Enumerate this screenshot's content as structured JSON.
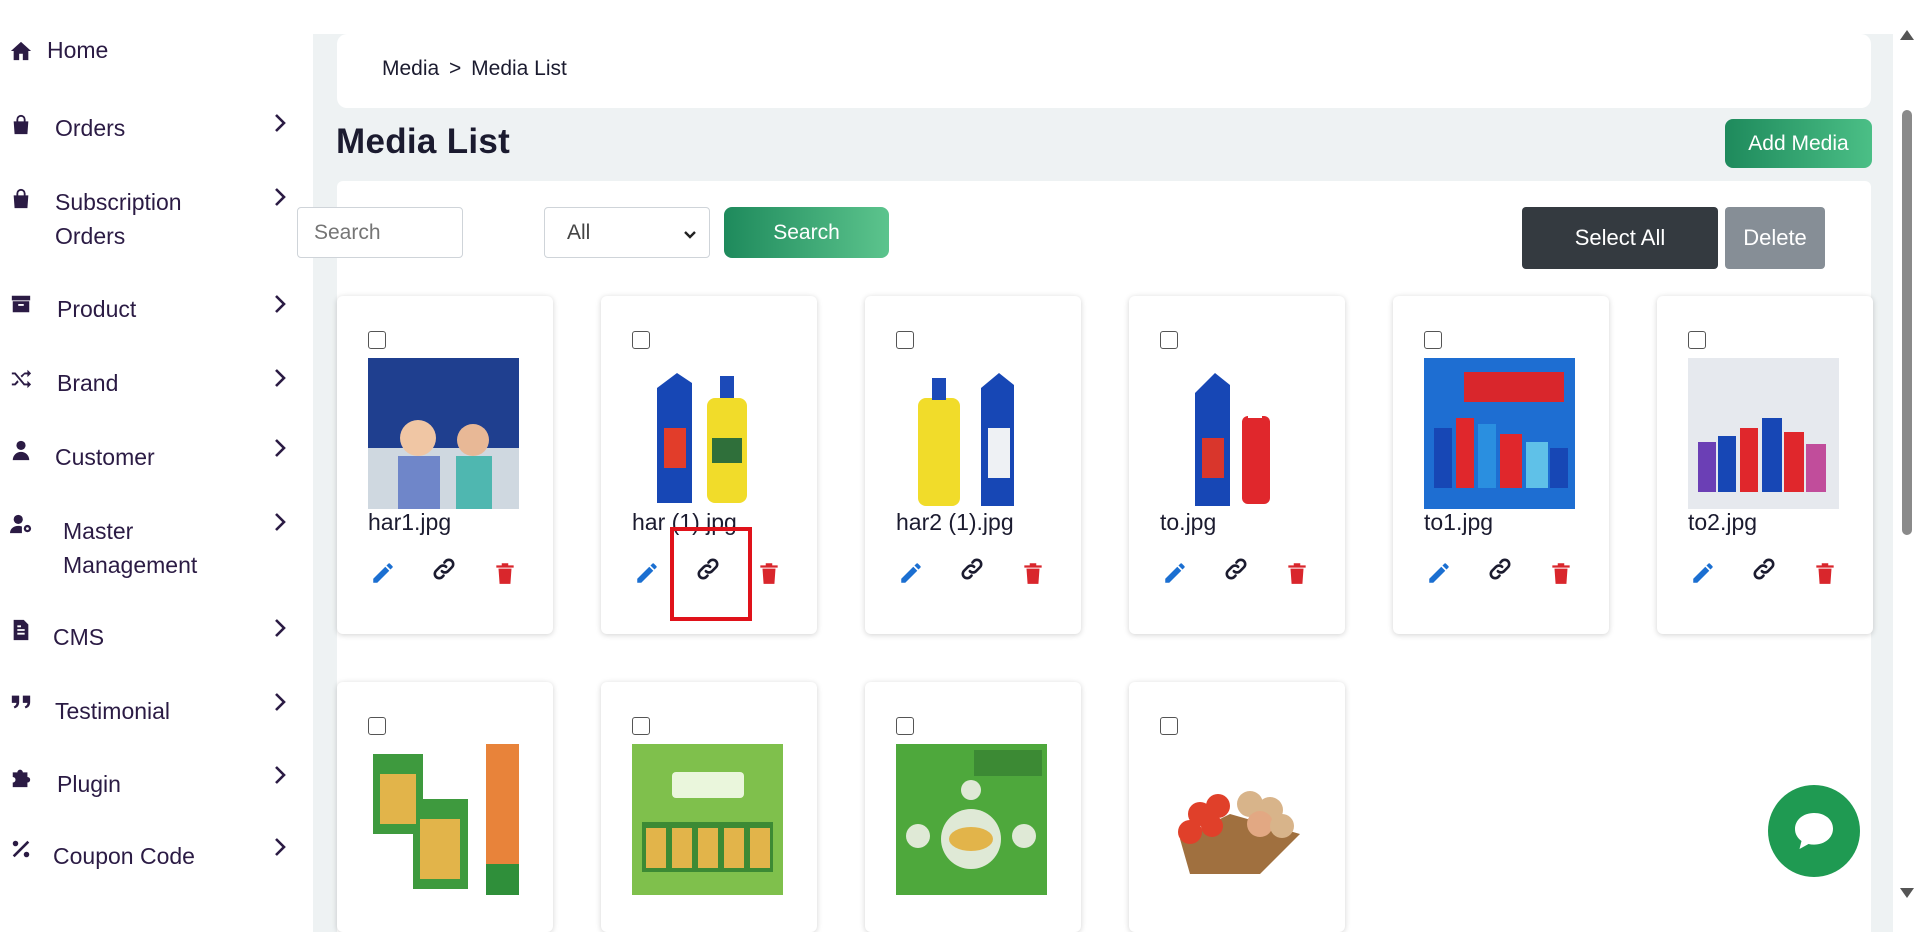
{
  "sidebar": {
    "items": [
      {
        "label": "Home",
        "icon": "home-icon",
        "has_chevron": false
      },
      {
        "label": "Orders",
        "icon": "shopping-bag-icon",
        "has_chevron": true
      },
      {
        "label": "Subscription Orders",
        "line1": "Subscription",
        "line2": "Orders",
        "icon": "shopping-bag-icon",
        "has_chevron": true
      },
      {
        "label": "Product",
        "icon": "archive-box-icon",
        "has_chevron": true
      },
      {
        "label": "Brand",
        "icon": "shuffle-icon",
        "has_chevron": true
      },
      {
        "label": "Customer",
        "icon": "user-icon",
        "has_chevron": true
      },
      {
        "label": "Master Management",
        "line1": "Master",
        "line2": "Management",
        "icon": "user-gear-icon",
        "has_chevron": true
      },
      {
        "label": "CMS",
        "icon": "document-icon",
        "has_chevron": true
      },
      {
        "label": "Testimonial",
        "icon": "quote-icon",
        "has_chevron": true
      },
      {
        "label": "Plugin",
        "icon": "puzzle-icon",
        "has_chevron": true
      },
      {
        "label": "Coupon Code",
        "icon": "percent-icon",
        "has_chevron": true
      }
    ]
  },
  "breadcrumb": {
    "root": "Media",
    "separator": ">",
    "current": "Media List"
  },
  "page": {
    "title": "Media List",
    "add_button": "Add Media"
  },
  "filters": {
    "search_placeholder": "Search",
    "select_value": "All",
    "search_button": "Search",
    "select_all_button": "Select All",
    "delete_button": "Delete"
  },
  "media": [
    {
      "name": "har1.jpg"
    },
    {
      "name": "har (1).jpg"
    },
    {
      "name": "har2 (1).jpg"
    },
    {
      "name": "to.jpg"
    },
    {
      "name": "to1.jpg"
    },
    {
      "name": "to2.jpg"
    },
    {
      "name": ""
    },
    {
      "name": ""
    },
    {
      "name": ""
    },
    {
      "name": ""
    }
  ],
  "colors": {
    "accent_green": "#1e8a5c",
    "edit_blue": "#1b6fd1",
    "trash_red": "#d9262c",
    "highlight_red": "#e0121a",
    "chat_green": "#1f9a52"
  }
}
